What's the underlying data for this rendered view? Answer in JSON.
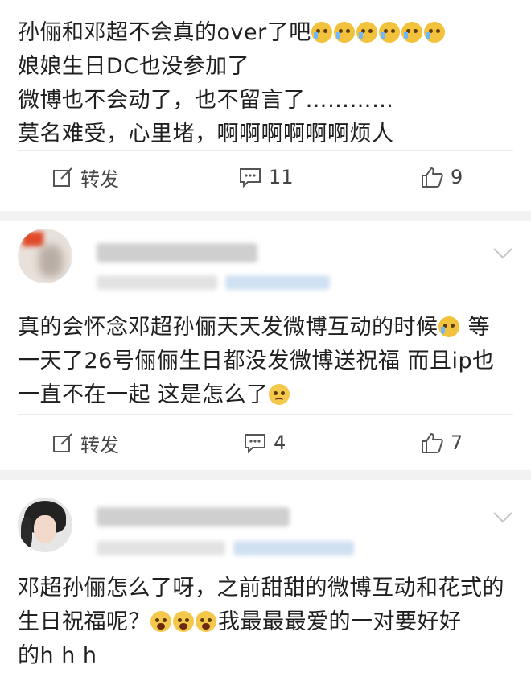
{
  "posts": [
    {
      "lines": [
        "孙俪和邓超不会真的over了吧",
        "娘娘生日DC也没参加了",
        "微博也不会动了，也不留言了…………",
        "莫名难受，心里堵，啊啊啊啊啊啊烦人"
      ],
      "repost_label": "转发",
      "comment_count": "11",
      "like_count": "9"
    },
    {
      "text_a": "真的会怀念邓超孙俪天天发微博互动的时候",
      "text_b": " 等一天了26号俪俪生日都没发微博送祝福 而且ip也一直不在一起 这是怎么了",
      "repost_label": "转发",
      "comment_count": "4",
      "like_count": "7"
    },
    {
      "text_a": "邓超孙俪怎么了呀，之前甜甜的微博互动和花式的生日祝福呢？",
      "text_b": "我最最最爱的一对要好好",
      "text_c": "的h h h"
    }
  ],
  "icons": {
    "repost": "edit-share-icon",
    "comment": "comment-icon",
    "like": "thumbs-up-icon",
    "more": "chevron-down-icon"
  },
  "colors": {
    "background": "#ffffff",
    "separator": "#f2f2f2",
    "text": "#1f1f1f"
  }
}
